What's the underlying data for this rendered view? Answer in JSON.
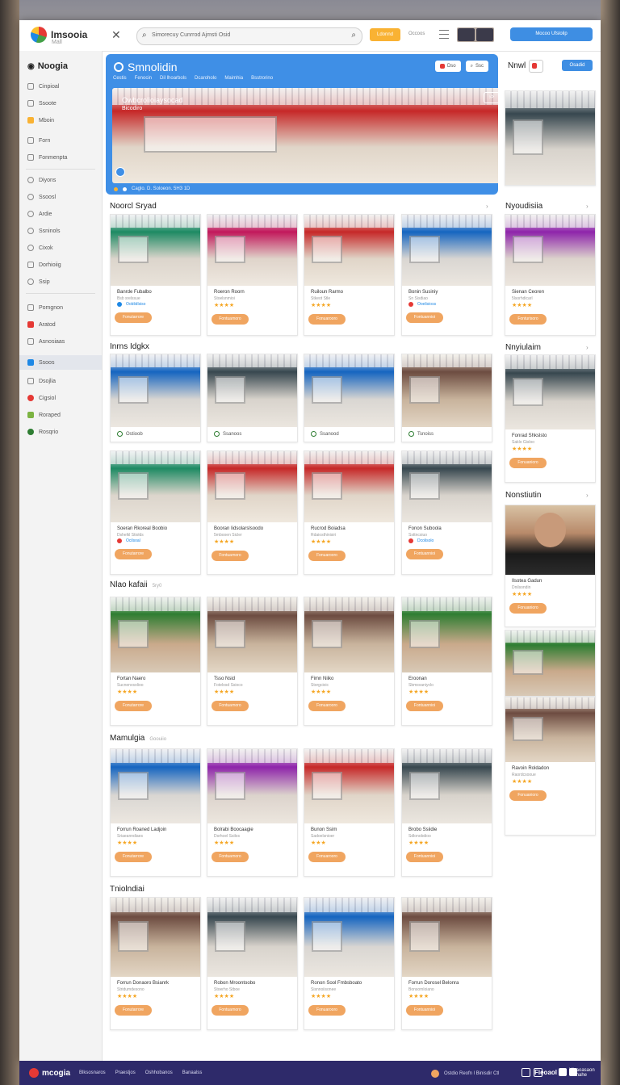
{
  "topbar": {
    "brand": "Imsooia",
    "brand_sub": "Mall",
    "search_placeholder": "Simorecuy Cunrrod Ajmsti Osid",
    "orange_btn": "Ldonnd",
    "toggle_label": "Occoos",
    "blue_btn": "Mocoo Ufslolip"
  },
  "sidebar": {
    "heading": "Noogia",
    "items": [
      "Cinpioal",
      "Ssoote",
      "Mboin",
      "Forn",
      "Fonmenpta",
      "Diyons",
      "Ssoosl",
      "Ardie",
      "Ssninols",
      "Cixok",
      "Dorhioiig",
      "Ssip",
      "Pomgnon",
      "Aratod",
      "Asnosiaas",
      "Ssoos",
      "Dsojlia",
      "Cigsiol",
      "Roraped",
      "Rosqrio"
    ]
  },
  "hero": {
    "title": "Smnolidin",
    "tabs": [
      "Cestis",
      "Fenocin",
      "Dil lhoarbols",
      "Dcaroholo",
      "Maimhia",
      "Bsstrorino"
    ],
    "btn_a": "Dso",
    "btn_b": "Ssc",
    "caption": "Owbcrolioiaysocad",
    "caption2": "Bicodiro",
    "foot": "Caglo. D. Soloeon.  5H3 1D"
  },
  "right": {
    "title": "Nnwl",
    "btn": "Osadid",
    "sections": [
      "Nyoudisiia",
      "Nnyiulaim",
      "Nonstiutin"
    ]
  },
  "sections": {
    "s1": "Noorcl Sryad",
    "s2": "Inrns Idgkx",
    "s3": "Nlao kafaii",
    "s3_sub": "5ry0",
    "s4": "Mamulgia",
    "s4_sub": "Goouiio",
    "s5": "Tniolndiai"
  },
  "cards": {
    "row1": [
      {
        "name": "Banrde Fubalbo",
        "sub": "Bsb srelssue",
        "tag": "Ooblidlsiso",
        "stars": "",
        "cta": "Fonutarrore"
      },
      {
        "name": "Roeron Roorn",
        "sub": "Stoelsnmioi",
        "tag": "",
        "stars": "★★★★",
        "cta": "Fontuarnoro"
      },
      {
        "name": "Ruiloun Rarmo",
        "sub": "Stkeot Stle",
        "tag": "",
        "stars": "★★★★",
        "cta": "Fonuarooro"
      },
      {
        "name": "Bonin Susiniy",
        "sub": "Sn Sisdiao",
        "tag": "Ooelisioss",
        "stars": "",
        "cta": "Fontuannioi"
      },
      {
        "name": "Sienan Ceoren",
        "sub": "5lsorhdicarl",
        "tag": "",
        "stars": "★★★★",
        "cta": "Fonturisoro"
      }
    ],
    "row2": [
      {
        "chk": "Ostioob"
      },
      {
        "chk": "Ssanoos"
      },
      {
        "chk": "Ssanood"
      },
      {
        "chk": "Tsnoiss"
      }
    ],
    "row2_right": {
      "name": "Fonrad Shkslsto",
      "sub": "Saklo Gisloo",
      "stars": "★★★★",
      "cta": "Fonuanioro"
    },
    "row3": [
      {
        "name": "Soeran Rkoreal Boobio",
        "sub": "Dshelkl Stiolds",
        "tag": "Ocilsoal",
        "stars": "",
        "cta": "Fonutarrore"
      },
      {
        "name": "Booran Iidsolarslsoodo",
        "sub": "5mbooen Sicler",
        "tag": "",
        "stars": "★★★★",
        "cta": "Fontuarnoro"
      },
      {
        "name": "Rucrod Boiadsa",
        "sub": "Rdaiosthinisiri",
        "tag": "",
        "stars": "★★★★",
        "cta": "Fonuarooro"
      },
      {
        "name": "Fonon Suboola",
        "sub": "Ssttncsiuo",
        "tag": "Dcolisolo",
        "stars": "",
        "cta": "Fontuannioi"
      }
    ],
    "row3_right": {
      "name": "Ilsotea Gadun",
      "sub": "Dnilsondin",
      "stars": "★★★★",
      "cta": "Fonuanioro"
    },
    "row4": [
      {
        "name": "Fortan Naero",
        "sub": "Sucnenvsolioo",
        "stars": "★★★★",
        "cta": "Fonutarrore"
      },
      {
        "name": "Tsso Nsid",
        "sub": "Fotelosd Ssioco",
        "stars": "★★★★",
        "cta": "Fontuarnoro"
      },
      {
        "name": "Fimn Niiko",
        "sub": "Storgcioic",
        "stars": "★★★★",
        "cta": "Fonuarooro"
      },
      {
        "name": "Eroonan",
        "sub": "Sbmsvaniyclo",
        "stars": "★★★★",
        "cta": "Fontuannioi"
      }
    ],
    "row5": [
      {
        "name": "Forrun Roaned Ladjoin",
        "sub": "Sriaeanndiaes",
        "stars": "★★★★",
        "cta": "Fonutarrore"
      },
      {
        "name": "Bolrabi Boocaagie",
        "sub": "Dsrhoel Ssilos",
        "stars": "★★★★",
        "cta": "Fontuarnoro"
      },
      {
        "name": "Bunon Ssim",
        "sub": "Sadoelsnioer",
        "stars": "★★★",
        "cta": "Fonuarooro"
      },
      {
        "name": "Brobo Ssiidie",
        "sub": "Sdlonobdioo",
        "stars": "★★★★",
        "cta": "Fontuannioi"
      }
    ],
    "row5_right": {
      "name": "Ravoin Roldadon",
      "sub": "Raordcsooue",
      "stars": "★★★★",
      "cta": "Fonuanioro"
    },
    "row6": [
      {
        "name": "Forrun Donaoro Bsianrk",
        "sub": "Stridumdesono",
        "stars": "★★★★",
        "cta": "Fonutarrore"
      },
      {
        "name": "Robon Mroontoobo",
        "sub": "Stoerho Stboe",
        "stars": "★★★★",
        "cta": "Fontuarnoro"
      },
      {
        "name": "Ronon Sool Fmbsboato",
        "sub": "Sisnnoiisonee",
        "stars": "★★★★",
        "cta": "Fonuarooro"
      },
      {
        "name": "Forrun Dorosel Belonra",
        "sub": "Bonsomloiano",
        "stars": "★★★★",
        "cta": "Fontuannioi"
      }
    ]
  },
  "footer": {
    "brand": "mcogia",
    "links": [
      "Blksosnaros",
      "Praestjos",
      "Oshhobanos",
      "Banaalss"
    ],
    "right_text": "Ostdio Reofn l Binisdir Ctl",
    "btn": "Fieoaol",
    "sub": "Ulcaoasaon Scmahe"
  }
}
